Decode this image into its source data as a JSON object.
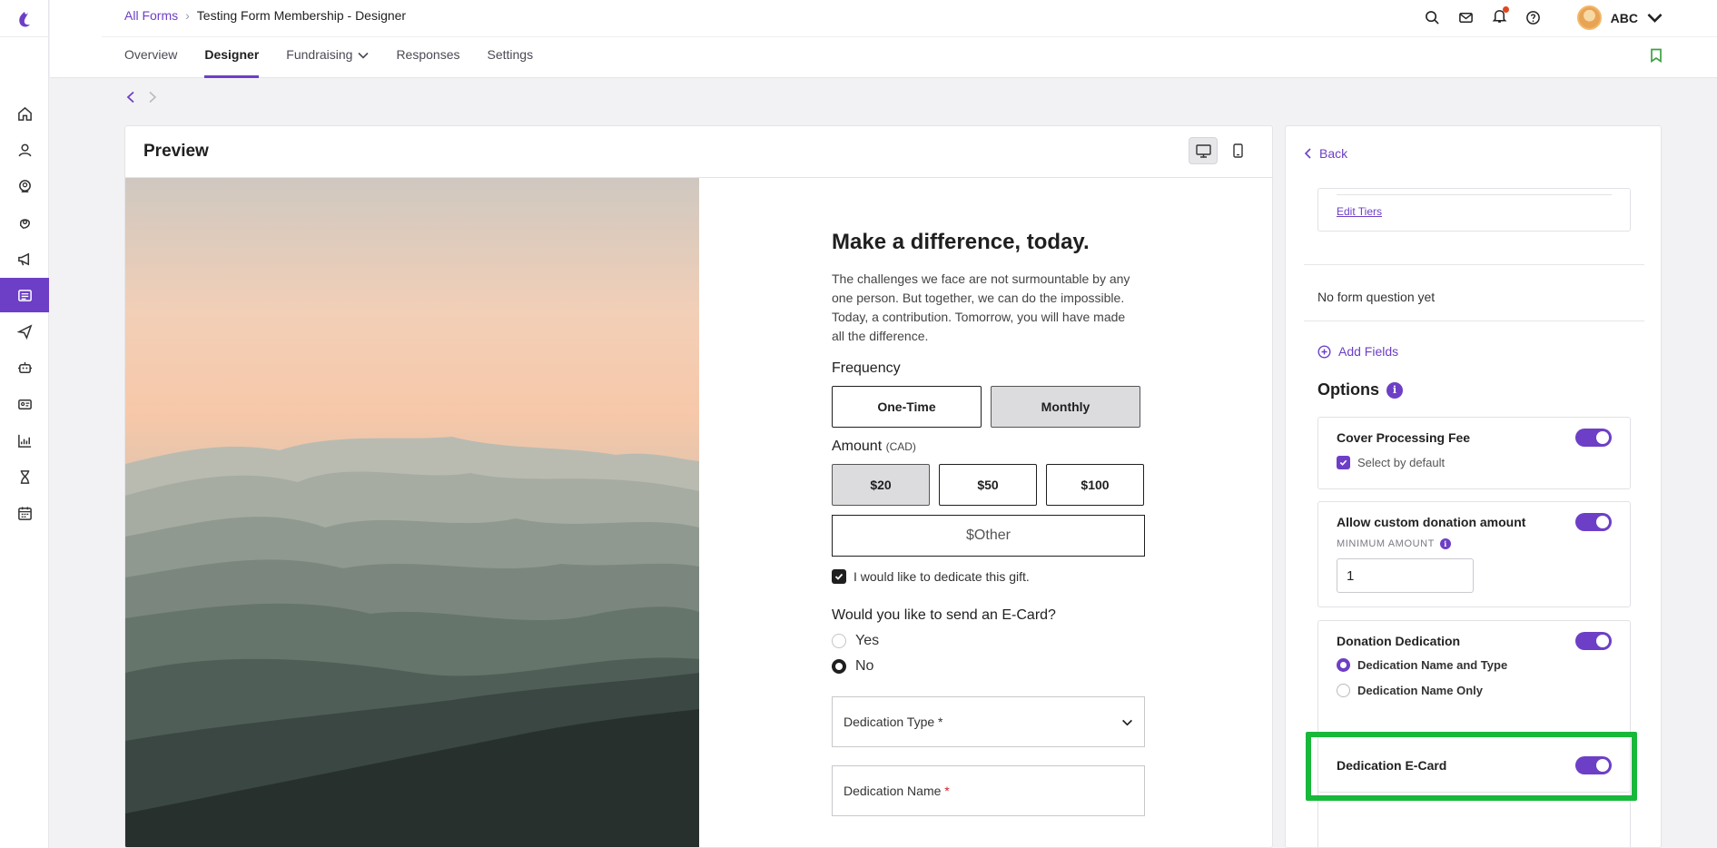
{
  "breadcrumb": {
    "root": "All Forms",
    "current": "Testing Form Membership - Designer"
  },
  "tabs": [
    {
      "label": "Overview"
    },
    {
      "label": "Designer"
    },
    {
      "label": "Fundraising"
    },
    {
      "label": "Responses"
    },
    {
      "label": "Settings"
    }
  ],
  "user": {
    "name": "ABC"
  },
  "preview": {
    "title": "Preview",
    "heading": "Make a difference, today.",
    "description": "The challenges we face are not surmountable by any one person. But together, we can do the impossible. Today, a contribution. Tomorrow, you will have made all the difference.",
    "frequency_label": "Frequency",
    "frequency_options": [
      "One-Time",
      "Monthly"
    ],
    "amount_label": "Amount",
    "currency": "(CAD)",
    "amounts": [
      "$20",
      "$50",
      "$100"
    ],
    "other_amount": "$Other",
    "dedicate_label": "I would like to dedicate this gift.",
    "ecard_question": "Would you like to send an E-Card?",
    "ecard_options": [
      "Yes",
      "No"
    ],
    "dedication_type": "Dedication Type *",
    "dedication_name": "Dedication Name"
  },
  "panel": {
    "back": "Back",
    "edit_tiers": "Edit Tiers",
    "no_question": "No form question yet",
    "add_fields": "Add Fields",
    "options_heading": "Options",
    "info_glyph": "i",
    "cover_fee": {
      "title": "Cover Processing Fee",
      "checkbox": "Select by default"
    },
    "custom_amount": {
      "title": "Allow custom donation amount",
      "min_label": "MINIMUM AMOUNT",
      "min_value": "1"
    },
    "dedication": {
      "title": "Donation Dedication",
      "options": [
        "Dedication Name and Type",
        "Dedication Name Only"
      ]
    },
    "ecard": {
      "title": "Dedication E-Card"
    }
  },
  "colors": {
    "accent": "#6d3fc6",
    "highlight": "#18b83a"
  }
}
